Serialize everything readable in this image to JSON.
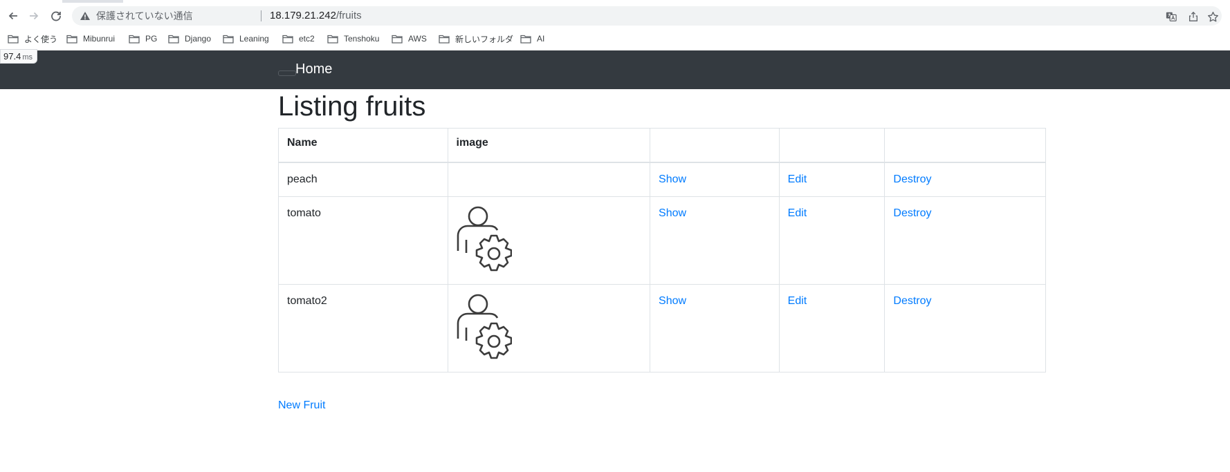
{
  "browser": {
    "security_label": "保護されていない通信",
    "url_host": "18.179.21.242",
    "url_path": "/fruits",
    "bookmarks": [
      "よく使う",
      "Mibunrui",
      "PG",
      "Django",
      "Leaning",
      "etc2",
      "Tenshoku",
      "AWS",
      "新しいフォルダ",
      "AI"
    ],
    "timing_value": "97.4",
    "timing_unit": "ms"
  },
  "navbar": {
    "brand": "Home"
  },
  "page": {
    "title": "Listing fruits",
    "table_headers": [
      "Name",
      "image",
      "",
      "",
      ""
    ],
    "rows": [
      {
        "name": "peach",
        "has_image": false,
        "show": "Show",
        "edit": "Edit",
        "destroy": "Destroy"
      },
      {
        "name": "tomato",
        "has_image": true,
        "image_icon": "user-gear-icon",
        "show": "Show",
        "edit": "Edit",
        "destroy": "Destroy"
      },
      {
        "name": "tomato2",
        "has_image": true,
        "image_icon": "user-gear-icon",
        "show": "Show",
        "edit": "Edit",
        "destroy": "Destroy"
      }
    ],
    "new_link": "New Fruit"
  },
  "colors": {
    "navbar_bg": "#343a40",
    "link": "#007bff",
    "text": "#212529",
    "border": "#dee2e6"
  }
}
